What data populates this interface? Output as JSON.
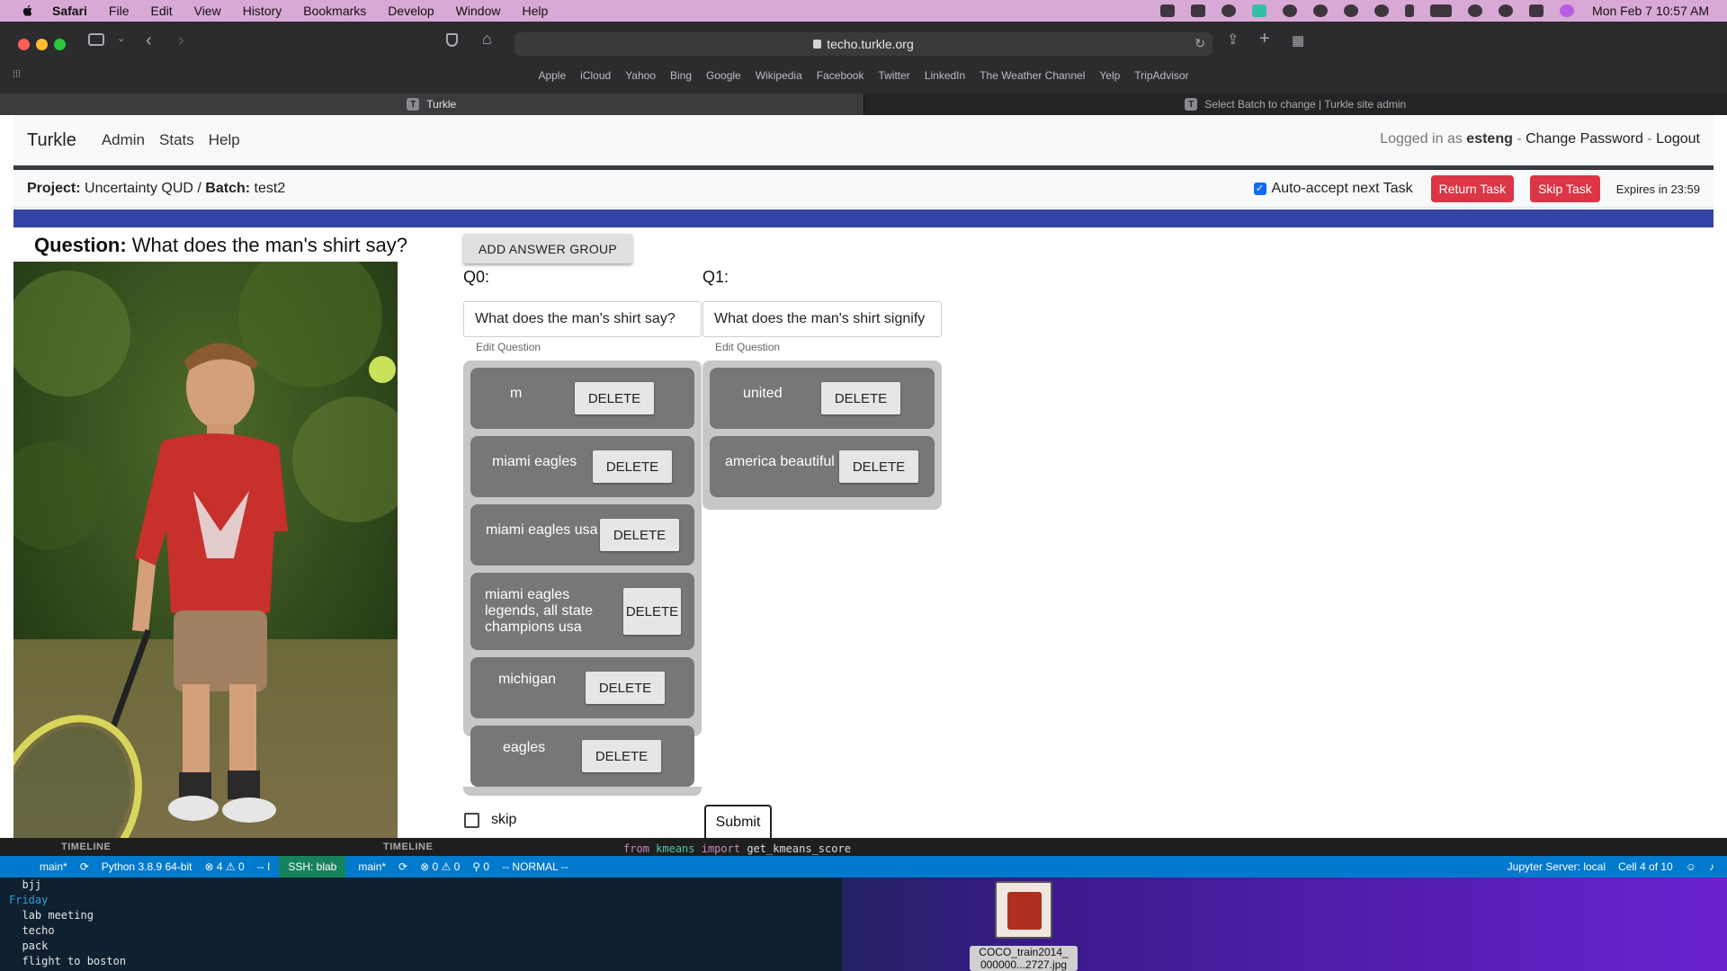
{
  "menubar": {
    "items": [
      "Safari",
      "File",
      "Edit",
      "View",
      "History",
      "Bookmarks",
      "Develop",
      "Window",
      "Help"
    ],
    "clock": "Mon Feb 7  10:57 AM"
  },
  "browser": {
    "url": "techo.turkle.org",
    "favorites": [
      "Apple",
      "iCloud",
      "Yahoo",
      "Bing",
      "Google",
      "Wikipedia",
      "Facebook",
      "Twitter",
      "LinkedIn",
      "The Weather Channel",
      "Yelp",
      "TripAdvisor"
    ],
    "tabs": [
      {
        "title": "Turkle",
        "favicon": "T"
      },
      {
        "title": "Select Batch to change | Turkle site admin",
        "favicon": "T"
      }
    ]
  },
  "turkle": {
    "brand": "Turkle",
    "nav": [
      "Admin",
      "Stats",
      "Help"
    ],
    "logged_in_prefix": "Logged in as",
    "username": "esteng",
    "sep1": " - ",
    "change_password": "Change Password",
    "sep2": " - ",
    "logout": "Logout"
  },
  "project_bar": {
    "project_label": "Project:",
    "project_name": "Uncertainty QUD",
    "sep": " / ",
    "batch_label": "Batch:",
    "batch_name": "test2",
    "auto_accept_label": "Auto-accept next Task",
    "auto_accept_checked": true,
    "return_task": "Return Task",
    "skip_task": "Skip Task",
    "expires": "Expires in 23:59"
  },
  "task": {
    "question_label": "Question:",
    "question_text": "What does the man's shirt say?",
    "add_answer_group": "ADD ANSWER GROUP",
    "edit_question_label": "Edit Question",
    "delete_label": "DELETE",
    "groups": [
      {
        "label": "Q0:",
        "question": "What does the man's shirt say?",
        "answers": [
          "m",
          "miami eagles",
          "miami eagles usa",
          "miami eagles legends, all state champions usa",
          "michigan",
          "eagles"
        ]
      },
      {
        "label": "Q1:",
        "question": "What does the man's shirt signify",
        "answers": [
          "united",
          "america beautiful"
        ]
      }
    ],
    "skip_label": "skip",
    "skip_checked": false,
    "submit_label": "Submit"
  },
  "vscode": {
    "timeline_label": "TIMELINE",
    "code_from": "from",
    "code_module": "kmeans",
    "code_import": "import",
    "code_name": "get_kmeans_score",
    "status_left": [
      "main*",
      "Python 3.8.9 64-bit",
      "⊗ 4 ⚠ 0",
      "-- I"
    ],
    "remote": "SSH: blab",
    "status_mid": [
      "main*",
      "⊗ 0 ⚠ 0",
      "⚲ 0",
      "-- NORMAL --"
    ],
    "status_right": [
      "Jupyter Server: local",
      "Cell 4 of 10"
    ]
  },
  "terminal": {
    "lines": [
      {
        "text": "  bjj",
        "type": "item"
      },
      {
        "text": "Friday",
        "type": "day"
      },
      {
        "text": "  lab meeting",
        "type": "item"
      },
      {
        "text": "  techo",
        "type": "item"
      },
      {
        "text": "  pack",
        "type": "item"
      },
      {
        "text": "  flight to boston",
        "type": "item"
      }
    ]
  },
  "desktop_file": {
    "label_line1": "COCO_train2014_",
    "label_line2": "000000...2727.jpg"
  }
}
